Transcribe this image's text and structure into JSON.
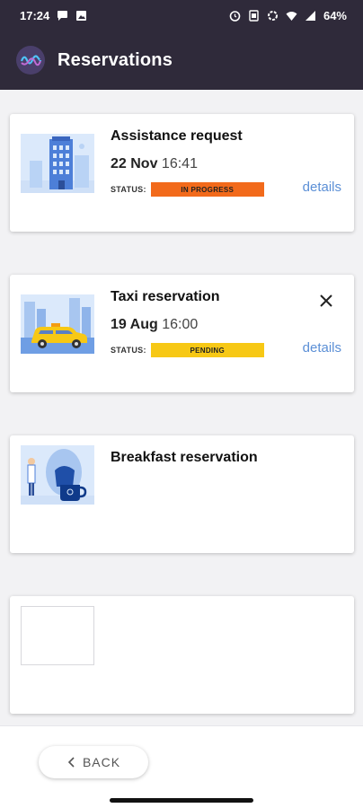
{
  "status_bar": {
    "time": "17:24",
    "battery": "64%",
    "left_icons": [
      "chat-bubble-icon",
      "image-icon"
    ],
    "right_icons": [
      "alarm-icon",
      "vibrate-icon",
      "data-saver-icon",
      "wifi-icon",
      "signal-icon",
      "battery-icon"
    ]
  },
  "header": {
    "title": "Reservations",
    "logo_icon": "app-logo-icon",
    "background": "#2f2a3a"
  },
  "reservations": [
    {
      "title": "Assistance request",
      "date": "22 Nov",
      "time": "16:41",
      "status_label": "STATUS:",
      "status": "IN PROGRESS",
      "status_color": "#f26a1b",
      "details_label": "details",
      "image": "hotel-building-illustration"
    },
    {
      "title": "Taxi reservation",
      "date": "19 Aug",
      "time": "16:00",
      "status_label": "STATUS:",
      "status": "PENDING",
      "status_color": "#f7c815",
      "details_label": "details",
      "image": "taxi-illustration",
      "close_icon": "close-icon"
    },
    {
      "title": "Breakfast reservation",
      "image": "breakfast-illustration"
    },
    {
      "title": "",
      "image": "empty-placeholder"
    }
  ],
  "footer": {
    "back_label": "BACK",
    "back_icon": "chevron-left-icon"
  },
  "accent_link_color": "#5b8fd6"
}
